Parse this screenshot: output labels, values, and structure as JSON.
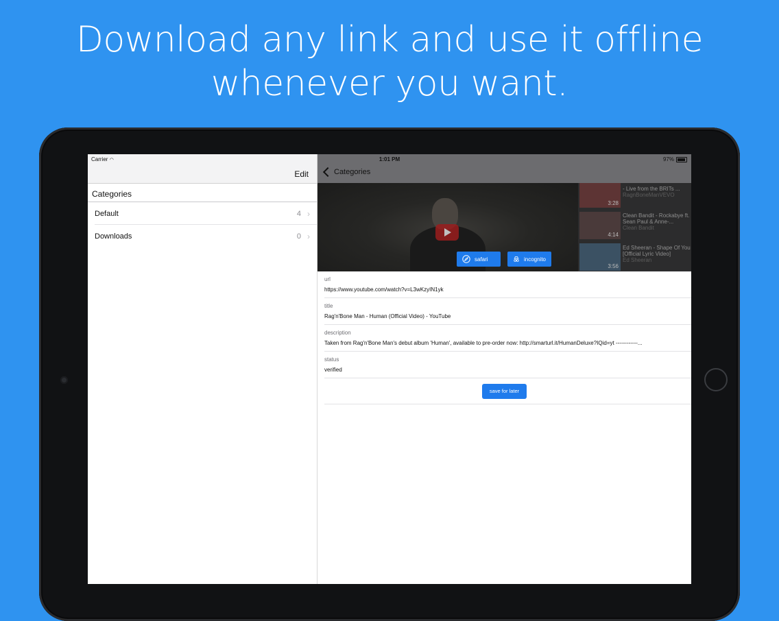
{
  "headline": {
    "line1": "Download any link and use it offline",
    "line2": "whenever you want."
  },
  "status_bar": {
    "carrier": "Carrier",
    "time": "1:01 PM",
    "battery": "97%"
  },
  "master": {
    "edit_label": "Edit",
    "section_title": "Categories",
    "items": [
      {
        "label": "Default",
        "count": "4"
      },
      {
        "label": "Downloads",
        "count": "0"
      }
    ]
  },
  "detail": {
    "back_label": "Categories",
    "preview": {
      "related": [
        {
          "title": "- Live from the BRITs ...",
          "channel": "RagnBoneManVEVO",
          "duration": "3:28"
        },
        {
          "title": "Clean Bandit - Rockabye ft. Sean Paul & Anne-...",
          "channel": "Clean Bandit",
          "duration": "4:14"
        },
        {
          "title": "Ed Sheeran - Shape Of You [Official Lyric Video]",
          "channel": "Ed Sheeran",
          "duration": "3:56"
        }
      ],
      "buttons": {
        "safari": "safari",
        "incognito": "incognito"
      }
    },
    "fields": [
      {
        "label": "url",
        "value": "https://www.youtube.com/watch?v=L3wKzyIN1yk"
      },
      {
        "label": "title",
        "value": "Rag'n'Bone Man - Human (Official Video) - YouTube"
      },
      {
        "label": "description",
        "value": "Taken from Rag'n'Bone Man's debut album 'Human', available to pre-order now: http://smarturl.it/HumanDeluxe?IQid=yt ------------..."
      },
      {
        "label": "status",
        "value": "verified"
      }
    ],
    "save_label": "save for later"
  },
  "colors": {
    "background": "#2f93f0",
    "accent_button": "#1f7bec"
  }
}
